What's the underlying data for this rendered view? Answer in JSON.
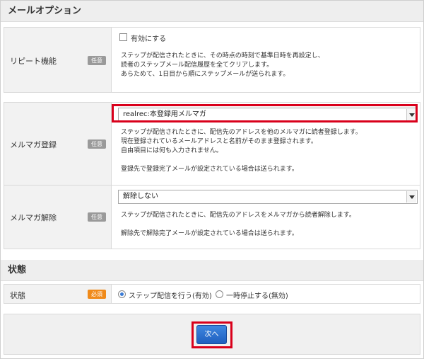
{
  "mail_options": {
    "title": "メールオプション",
    "repeat": {
      "label": "リピート機能",
      "badge": "任意",
      "checkbox_label": "有効にする",
      "desc_lines": [
        "ステップが配信されたときに、その時点の時刻で基準日時を再設定し、",
        "読者のステップメール配信履歴を全てクリアします。",
        "あらためて、1日目から順にステップメールが送られます。"
      ]
    },
    "register": {
      "label": "メルマガ登録",
      "badge": "任意",
      "selected": "realrec:本登録用メルマガ",
      "desc_lines": [
        "ステップが配信されたときに、配信先のアドレスを他のメルマガに読者登録します。",
        "現在登録されているメールアドレスと名前がそのまま登録されます。",
        "自由項目には何も入力されません。",
        "",
        "登録先で登録完了メールが設定されている場合は送られます。"
      ]
    },
    "unregister": {
      "label": "メルマガ解除",
      "badge": "任意",
      "selected": "解除しない",
      "desc_lines": [
        "ステップが配信されたときに、配信先のアドレスをメルマガから読者解除します。",
        "",
        "解除先で解除完了メールが設定されている場合は送られます。"
      ]
    }
  },
  "status_section": {
    "title": "状態",
    "label": "状態",
    "badge": "必須",
    "options": [
      {
        "label": "ステップ配信を行う(有効)",
        "selected": true
      },
      {
        "label": "一時停止する(無効)",
        "selected": false
      }
    ]
  },
  "footer": {
    "next_label": "次へ"
  },
  "colors": {
    "highlight": "#d9001b",
    "primary_button": "#2a6fd0",
    "required_badge": "#f08a1a",
    "optional_badge": "#9a9a9a"
  }
}
